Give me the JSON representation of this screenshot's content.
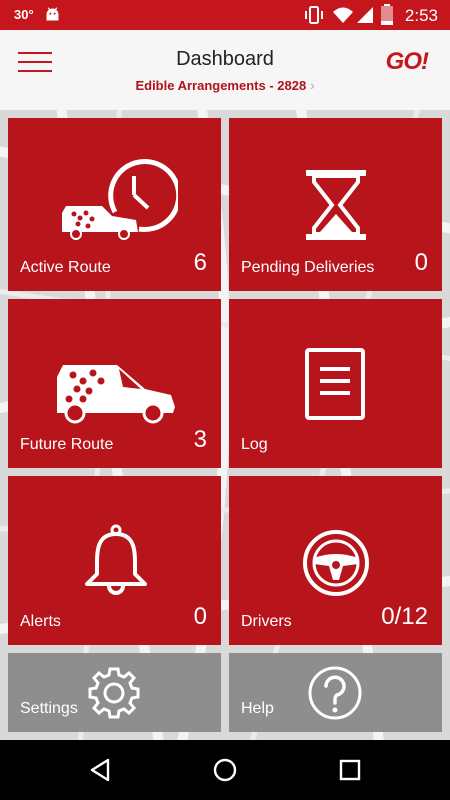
{
  "status_bar": {
    "temperature": "30°",
    "time": "2:53",
    "battery_level": "2"
  },
  "header": {
    "title": "Dashboard",
    "subtitle": "Edible Arrangements - 2828",
    "logo": "GO!"
  },
  "tiles": [
    {
      "label": "Active Route",
      "count": "6",
      "icon": "van-clock-icon"
    },
    {
      "label": "Pending Deliveries",
      "count": "0",
      "icon": "hourglass-icon"
    },
    {
      "label": "Future Route",
      "count": "3",
      "icon": "van-icon"
    },
    {
      "label": "Log",
      "count": "",
      "icon": "document-icon"
    },
    {
      "label": "Alerts",
      "count": "0",
      "icon": "bell-icon"
    },
    {
      "label": "Drivers",
      "count": "0/12",
      "icon": "steering-wheel-icon"
    },
    {
      "label": "Settings",
      "count": "",
      "icon": "gear-icon"
    },
    {
      "label": "Help",
      "count": "",
      "icon": "question-icon"
    }
  ],
  "colors": {
    "brand_red": "#c5161d",
    "tile_red": "#b8141b",
    "tile_gray": "#8e8e8e"
  }
}
